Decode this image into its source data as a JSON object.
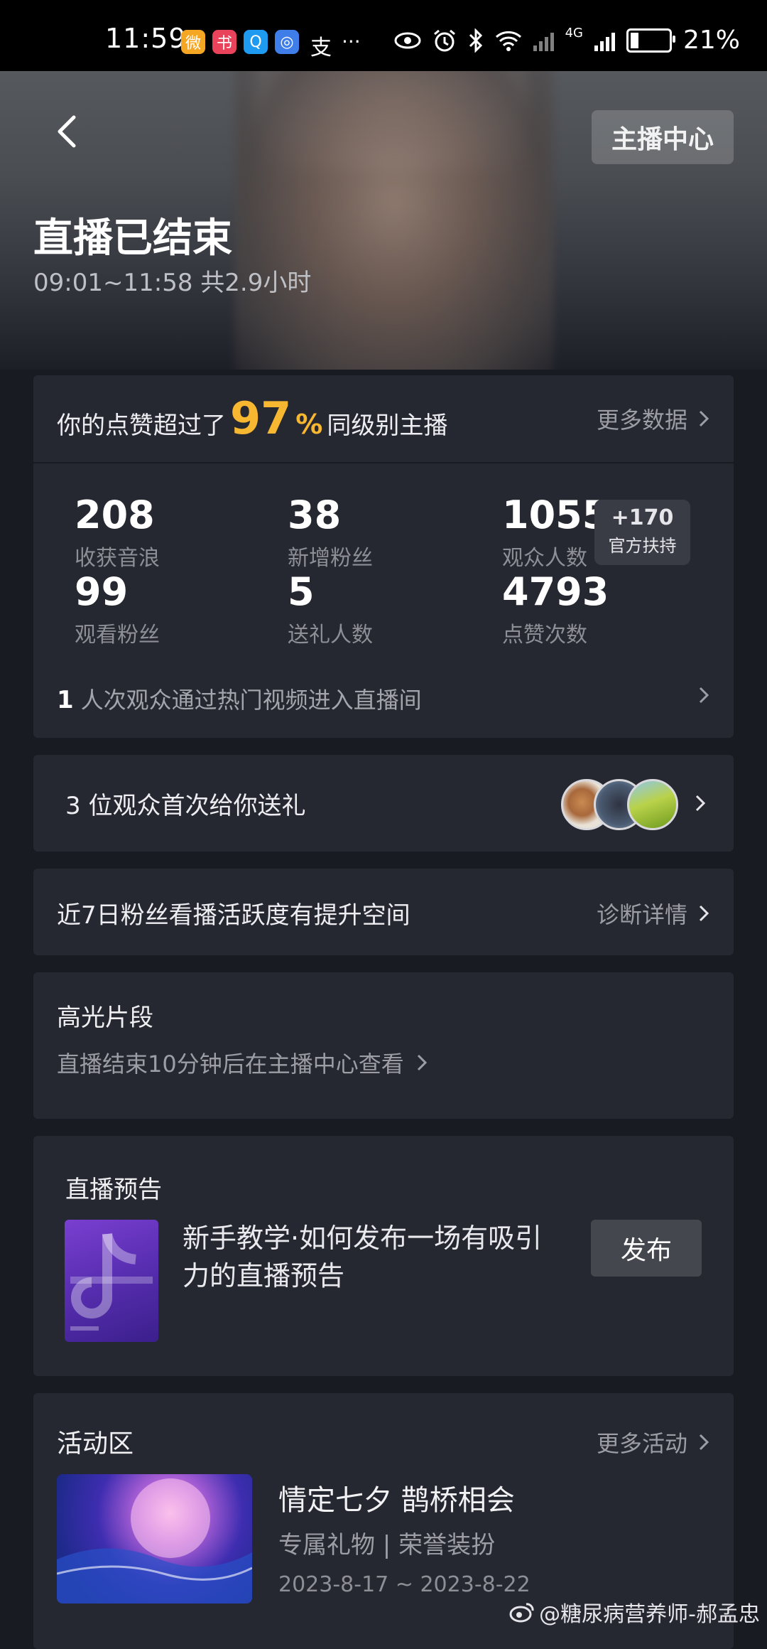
{
  "status_bar": {
    "time": "11:59",
    "app_icons": [
      {
        "icon": "weibo-icon",
        "color": "#f5a623",
        "glyph": "微"
      },
      {
        "icon": "reader-icon",
        "color": "#e8435a",
        "glyph": "书"
      },
      {
        "icon": "search-app-icon",
        "color": "#1e9bf0",
        "glyph": "Q"
      },
      {
        "icon": "browser-icon",
        "color": "#3f7ee8",
        "glyph": "◎"
      }
    ],
    "extra_glyph": "支",
    "more": "···",
    "network_label": "4G",
    "battery": "21%",
    "battery_level": 0.21
  },
  "header": {
    "anchor_center": "主播中心",
    "title": "直播已结束",
    "time_range": "09:01~11:58 共2.9小时"
  },
  "likes": {
    "prefix": "你的点赞超过了",
    "percent": "97",
    "percent_sign": "%",
    "suffix": "同级别主播",
    "more": "更多数据"
  },
  "stats": [
    {
      "value": "208",
      "label": "收获音浪"
    },
    {
      "value": "38",
      "label": "新增粉丝"
    },
    {
      "value": "1055",
      "label": "观众人数"
    },
    {
      "value": "99",
      "label": "观看粉丝"
    },
    {
      "value": "5",
      "label": "送礼人数"
    },
    {
      "value": "4793",
      "label": "点赞次数"
    }
  ],
  "official_support": {
    "value": "+170",
    "label": "官方扶持"
  },
  "hot_video": {
    "count": "1",
    "text": "人次观众通过热门视频进入直播间"
  },
  "first_gift": {
    "text": "3 位观众首次给你送礼"
  },
  "fan_activity": {
    "text": "近7日粉丝看播活跃度有提升空间",
    "link": "诊断详情"
  },
  "highlights": {
    "title": "高光片段",
    "sub": "直播结束10分钟后在主播中心查看"
  },
  "preview": {
    "title": "直播预告",
    "text": "新手教学·如何发布一场有吸引力的直播预告",
    "button": "发布"
  },
  "activities": {
    "title": "活动区",
    "more": "更多活动",
    "event_title": "情定七夕 鹊桥相会",
    "event_sub": "专属礼物 | 荣誉装扮",
    "event_date": "2023-8-17 ~ 2023-8-22"
  },
  "watermark": "@糖尿病营养师-郝孟忠"
}
